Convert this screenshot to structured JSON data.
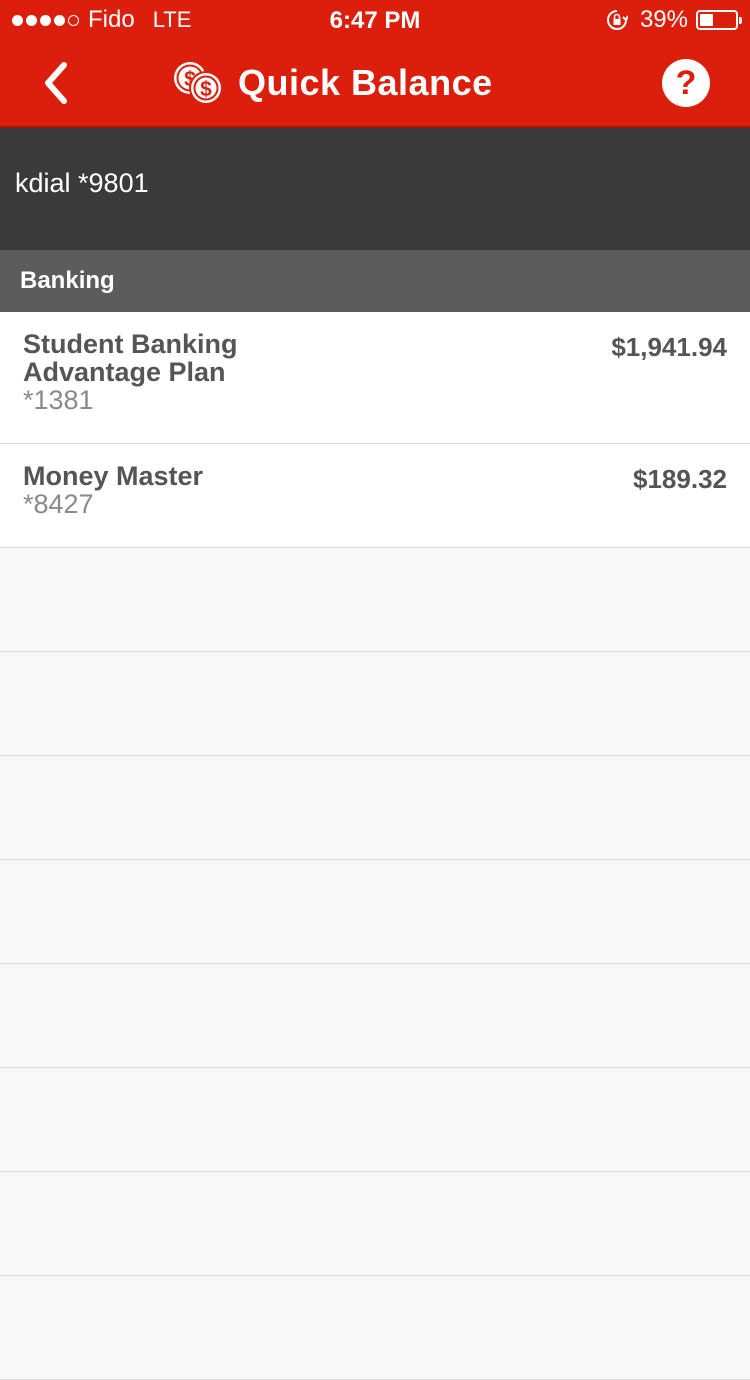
{
  "status_bar": {
    "signal_dots_filled": 4,
    "signal_dots_total": 5,
    "carrier": "Fido",
    "network": "LTE",
    "time": "6:47 PM",
    "battery_percent_label": "39%",
    "battery_level": 0.39
  },
  "nav": {
    "back_icon": "chevron-left-icon",
    "title_icon": "coins-icon",
    "title": "Quick Balance",
    "help_label": "?"
  },
  "profile": {
    "name": "kdial *9801"
  },
  "section": {
    "title": "Banking"
  },
  "accounts": [
    {
      "name": "Student Banking Advantage Plan",
      "number": "*1381",
      "balance": "$1,941.94"
    },
    {
      "name": "Money Master",
      "number": "*8427",
      "balance": "$189.32"
    }
  ],
  "colors": {
    "brand_red": "#db1f0c",
    "profile_bg": "#3a3a3a",
    "section_bg": "#5c5c5c",
    "text_dark": "#555555",
    "text_muted": "#8a8a8a"
  }
}
